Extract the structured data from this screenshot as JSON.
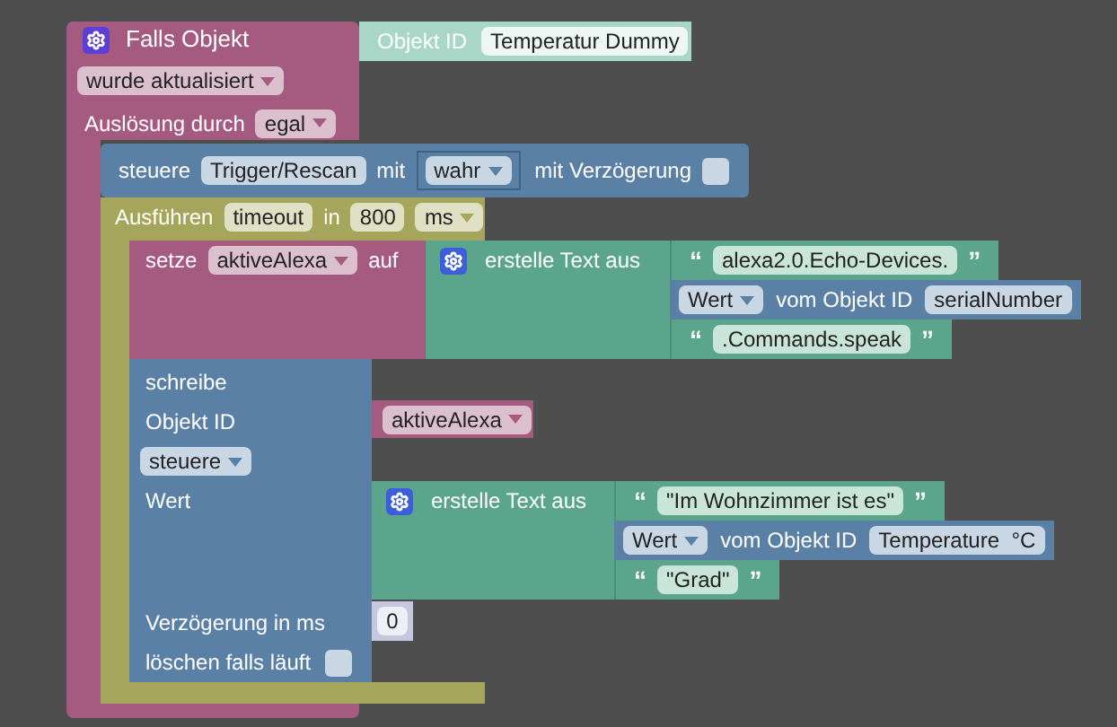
{
  "event": {
    "title": "Falls Objekt",
    "condition": "wurde aktualisiert",
    "trigger_label": "Auslösung durch",
    "trigger": "egal"
  },
  "object_id_block": {
    "label": "Objekt ID",
    "value": "Temperatur Dummy"
  },
  "control_block": {
    "label": "steuere",
    "target": "Trigger/Rescan",
    "with_label": "mit",
    "value": "wahr",
    "delay_label": "mit Verzögerung",
    "delay_checked": false
  },
  "timeout_block": {
    "label": "Ausführen",
    "name": "timeout",
    "in_label": "in",
    "duration": "800",
    "unit": "ms"
  },
  "set_block": {
    "label": "setze",
    "variable": "aktiveAlexa",
    "to_label": "auf"
  },
  "text_join_1": {
    "label": "erstelle Text aus",
    "items": [
      {
        "kind": "text",
        "open": "“",
        "value": "alexa2.0.Echo-Devices.",
        "close": "”"
      },
      {
        "kind": "state",
        "mode": "Wert",
        "of_label": "vom Objekt ID",
        "object": "serialNumber"
      },
      {
        "kind": "text",
        "open": "“",
        "value": ".Commands.speak",
        "close": "”"
      }
    ]
  },
  "write_block": {
    "label": "schreibe",
    "object_id_label": "Objekt ID",
    "variable": "aktiveAlexa",
    "mode": "steuere",
    "value_label": "Wert",
    "delay_label": "Verzögerung in ms",
    "delay": "0",
    "clear_label": "löschen falls läuft",
    "clear_checked": false
  },
  "text_join_2": {
    "label": "erstelle Text aus",
    "items": [
      {
        "kind": "text",
        "open": "“",
        "value": "\"Im Wohnzimmer ist es\"",
        "close": "”"
      },
      {
        "kind": "state",
        "mode": "Wert",
        "of_label": "vom Objekt ID",
        "object": "Temperature  °C"
      },
      {
        "kind": "text",
        "open": "“",
        "value": "\"Grad\"",
        "close": "”"
      }
    ]
  }
}
